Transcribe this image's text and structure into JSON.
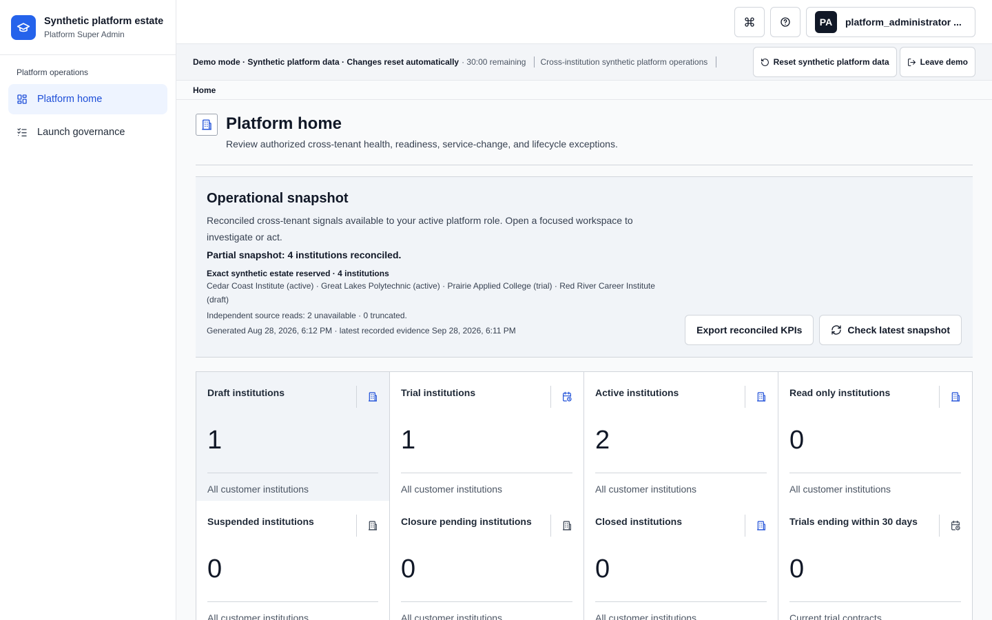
{
  "brand": {
    "title": "Synthetic platform estate",
    "subtitle": "Platform Super Admin",
    "icon": "graduation-cap-icon",
    "color": "#2563eb"
  },
  "sidebar": {
    "section": "Platform operations",
    "items": [
      {
        "label": "Platform home",
        "icon": "dashboard-grid-icon",
        "active": true
      },
      {
        "label": "Launch governance",
        "icon": "checklist-icon",
        "active": false
      }
    ]
  },
  "header": {
    "command_icon": "command-icon",
    "help_icon": "help-circle-icon",
    "user": {
      "initials": "PA",
      "name": "platform_administrator ..."
    }
  },
  "demo": {
    "message": "Demo mode · Synthetic platform data · Changes reset automatically",
    "remaining": "· 30:00 remaining",
    "scope": "Cross-institution synthetic platform operations",
    "reset_label": "Reset synthetic platform data",
    "leave_label": "Leave demo"
  },
  "breadcrumb": {
    "current": "Home"
  },
  "page": {
    "title": "Platform home",
    "subtitle": "Review authorized cross-tenant health, readiness, service-change, and lifecycle exceptions.",
    "icon": "building-icon"
  },
  "snapshot": {
    "title": "Operational snapshot",
    "description": "Reconciled cross-tenant signals available to your active platform role. Open a focused workspace to investigate or act.",
    "partial": "Partial snapshot: 4 institutions reconciled.",
    "exact": "Exact synthetic estate reserved · 4 institutions",
    "institutions": "Cedar Coast Institute (active) · Great Lakes Polytechnic (active) · Prairie Applied College (trial) · Red River Career Institute (draft)",
    "reads": "Independent source reads: 2 unavailable · 0 truncated.",
    "generated": "Generated Aug 28, 2026, 6:12 PM · latest recorded evidence Sep 28, 2026, 6:11 PM",
    "export_label": "Export reconciled KPIs",
    "check_label": "Check latest snapshot"
  },
  "kpis": [
    {
      "label": "Draft institutions",
      "value": "1",
      "foot": "All customer institutions",
      "icon": "building-icon",
      "icon_color": "#1d4ed8"
    },
    {
      "label": "Trial institutions",
      "value": "1",
      "foot": "All customer institutions",
      "icon": "calendar-clock-icon",
      "icon_color": "#1d4ed8"
    },
    {
      "label": "Active institutions",
      "value": "2",
      "foot": "All customer institutions",
      "icon": "building-icon",
      "icon_color": "#1d4ed8"
    },
    {
      "label": "Read only institutions",
      "value": "0",
      "foot": "All customer institutions",
      "icon": "building-icon",
      "icon_color": "#1d4ed8"
    },
    {
      "label": "Suspended institutions",
      "value": "0",
      "foot": "All customer institutions",
      "icon": "building-icon",
      "icon_color": "#374151"
    },
    {
      "label": "Closure pending institutions",
      "value": "0",
      "foot": "All customer institutions",
      "icon": "building-icon",
      "icon_color": "#374151"
    },
    {
      "label": "Closed institutions",
      "value": "0",
      "foot": "All customer institutions",
      "icon": "building-icon",
      "icon_color": "#1d4ed8"
    },
    {
      "label": "Trials ending within 30 days",
      "value": "0",
      "foot": "Current trial contracts",
      "icon": "calendar-clock-icon",
      "icon_color": "#374151"
    }
  ]
}
